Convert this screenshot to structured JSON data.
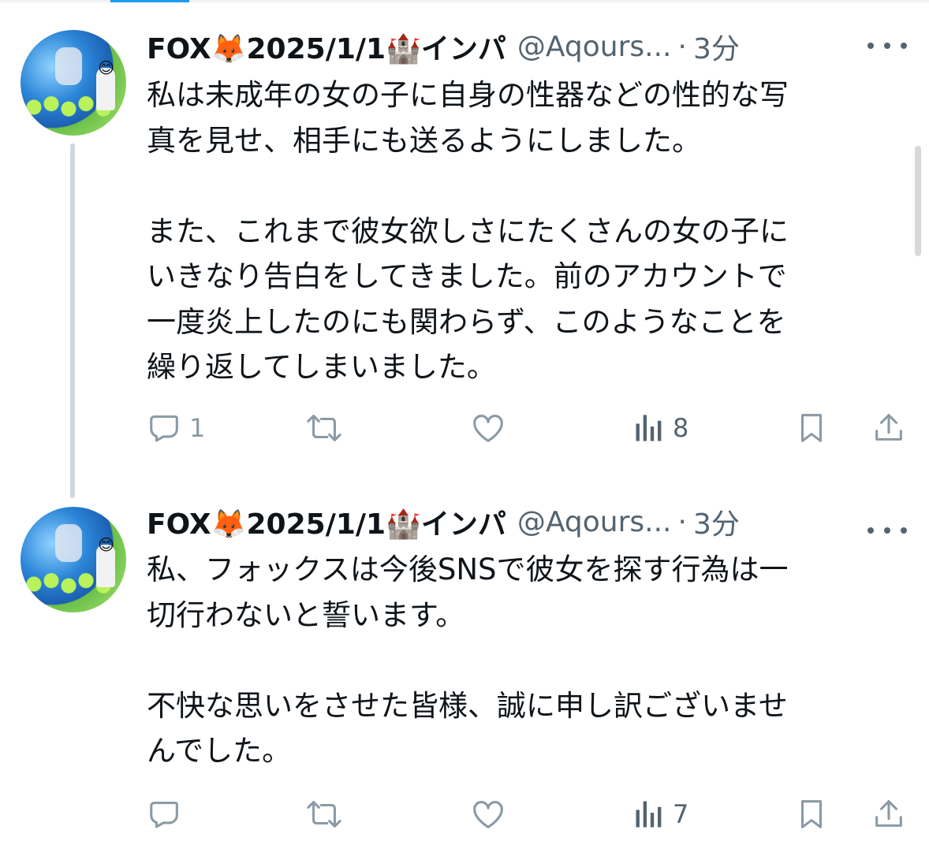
{
  "tweets": [
    {
      "display_name": "FOX🦊2025/1/1🏰インパ",
      "handle": "@Aqours...",
      "separator": "·",
      "time": "3分",
      "body": "私は未成年の女の子に自身の性器などの性的な写\n真を見せ、相手にも送るようにしました。\n\nまた、これまで彼女欲しさにたくさんの女の子に\nいきなり告白をしてきました。前のアカウントで\n一度炎上したのにも関わらず、このようなことを\n繰り返してしまいました。",
      "replies": "1",
      "views": "8"
    },
    {
      "display_name": "FOX🦊2025/1/1🏰インパ",
      "handle": "@Aqours...",
      "separator": "·",
      "time": "3分",
      "body": "私、フォックスは今後SNSで彼女を探す行為は一\n切行わないと誓います。\n\n不快な思いをさせた皆様、誠に申し訳ございませ\nんでした。",
      "replies": "",
      "views": "7"
    }
  ],
  "icons": {
    "reply": "speech-bubble-icon",
    "retweet": "repost-arrows-icon",
    "like": "heart-icon",
    "views": "bar-chart-icon",
    "bookmark": "bookmark-icon",
    "share": "share-upload-icon",
    "more": "more-dots-icon"
  },
  "colors": {
    "text": "#0f1419",
    "secondary": "#536471",
    "icon_muted": "#8a9aa5",
    "thread_line": "#cfd9de",
    "accent": "#1d9bf0"
  }
}
